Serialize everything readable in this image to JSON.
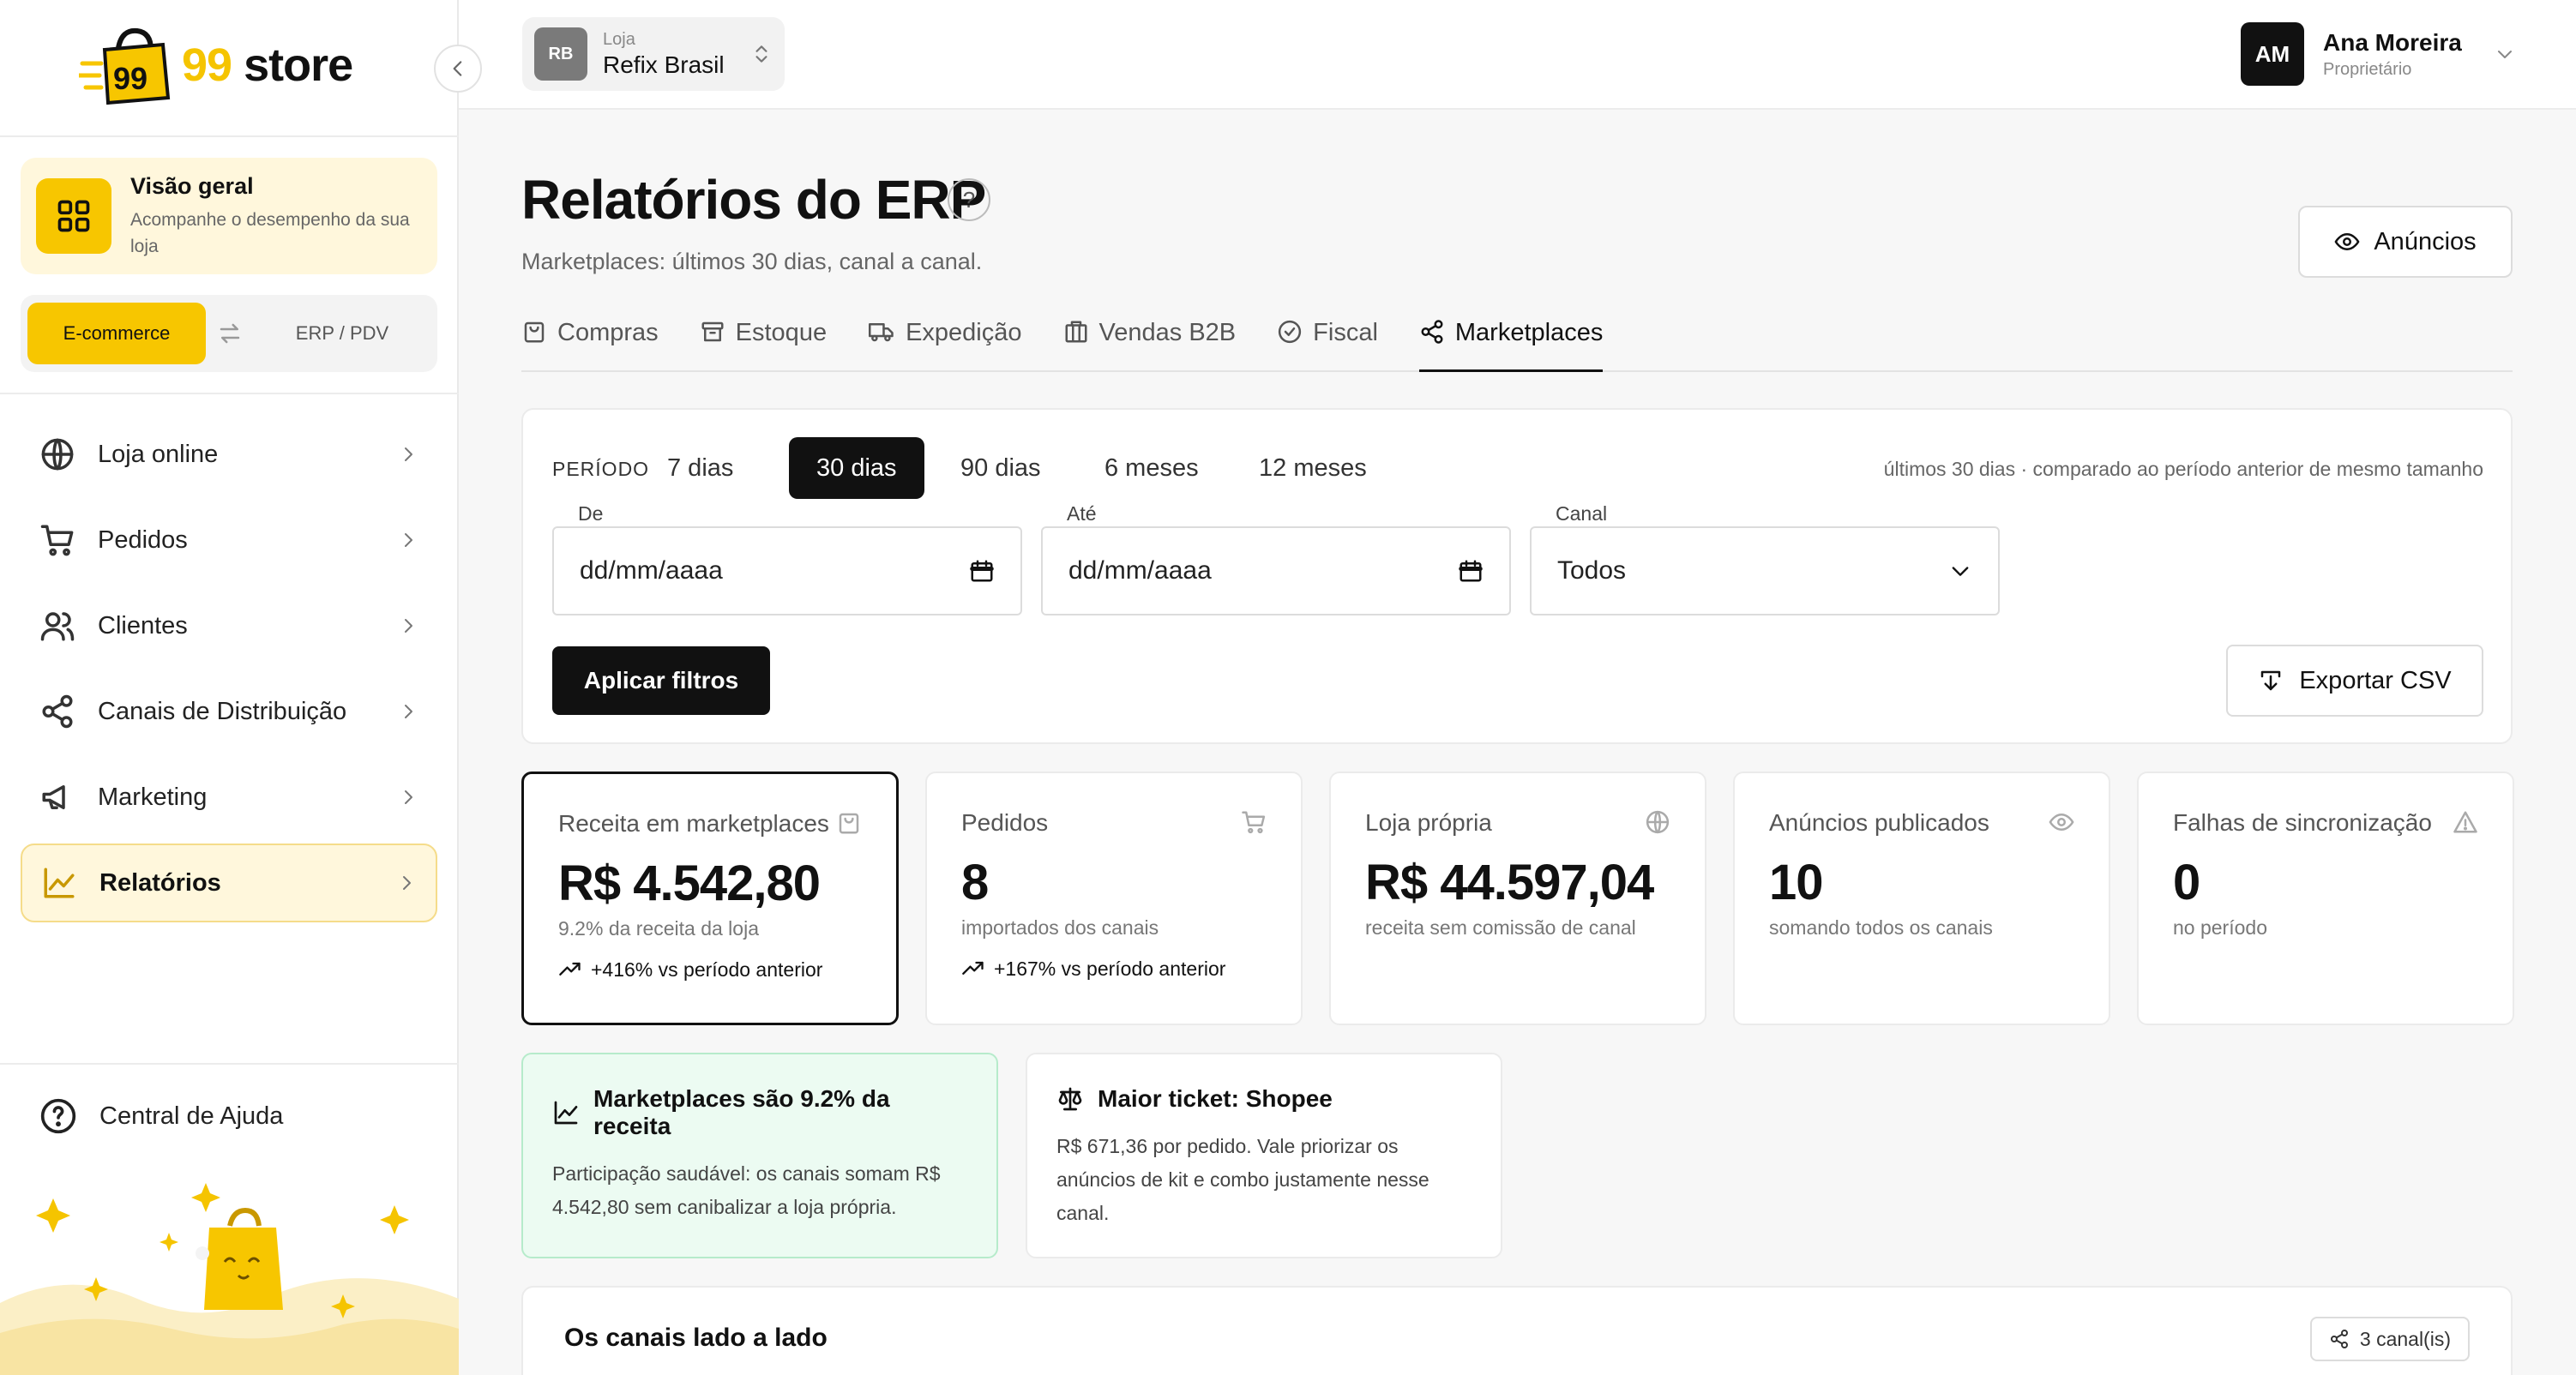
{
  "brand": {
    "name": "99 store"
  },
  "sidebar": {
    "overview": {
      "title": "Visão geral",
      "subtitle": "Acompanhe o desempenho da sua loja"
    },
    "mode_switch": {
      "active": "E-commerce",
      "inactive": "ERP / PDV"
    },
    "items": [
      {
        "label": "Loja online",
        "icon": "globe-icon"
      },
      {
        "label": "Pedidos",
        "icon": "cart-icon"
      },
      {
        "label": "Clientes",
        "icon": "users-icon"
      },
      {
        "label": "Canais de Distribuição",
        "icon": "share-icon"
      },
      {
        "label": "Marketing",
        "icon": "megaphone-icon"
      },
      {
        "label": "Relatórios",
        "icon": "chart-line-icon",
        "active": true
      }
    ],
    "help": "Central de Ajuda"
  },
  "topbar": {
    "store": {
      "initials": "RB",
      "label": "Loja",
      "name": "Refix Brasil"
    },
    "user": {
      "initials": "AM",
      "name": "Ana Moreira",
      "role": "Proprietário"
    }
  },
  "page": {
    "title": "Relatórios do ERP",
    "subtitle": "Marketplaces: últimos 30 dias, canal a canal.",
    "ads_button": "Anúncios"
  },
  "tabs": [
    {
      "label": "Compras",
      "icon": "bag-icon"
    },
    {
      "label": "Estoque",
      "icon": "archive-icon"
    },
    {
      "label": "Expedição",
      "icon": "truck-icon"
    },
    {
      "label": "Vendas B2B",
      "icon": "building-icon"
    },
    {
      "label": "Fiscal",
      "icon": "check-circle-icon"
    },
    {
      "label": "Marketplaces",
      "icon": "share-icon",
      "active": true
    }
  ],
  "filters": {
    "period_label": "PERÍODO",
    "periods": [
      "7 dias",
      "30 dias",
      "90 dias",
      "6 meses",
      "12 meses"
    ],
    "selected_period": "30 dias",
    "note": "últimos 30 dias · comparado ao período anterior de mesmo tamanho",
    "from": {
      "label": "De",
      "placeholder": "dd/mm/aaaa"
    },
    "to": {
      "label": "Até",
      "placeholder": "dd/mm/aaaa"
    },
    "channel": {
      "label": "Canal",
      "value": "Todos"
    },
    "apply": "Aplicar filtros",
    "export": "Exportar CSV"
  },
  "kpis": [
    {
      "title": "Receita em marketplaces",
      "value": "R$ 4.542,80",
      "sub": "9.2% da receita da loja",
      "trend": "+416% vs período anterior",
      "icon": "bag-icon"
    },
    {
      "title": "Pedidos",
      "value": "8",
      "sub": "importados dos canais",
      "trend": "+167% vs período anterior",
      "icon": "cart-icon"
    },
    {
      "title": "Loja própria",
      "value": "R$ 44.597,04",
      "sub": "receita sem comissão de canal",
      "icon": "globe-icon"
    },
    {
      "title": "Anúncios publicados",
      "value": "10",
      "sub": "somando todos os canais",
      "icon": "eye-icon"
    },
    {
      "title": "Falhas de sincronização",
      "value": "0",
      "sub": "no período",
      "icon": "alert-icon"
    }
  ],
  "insights": [
    {
      "title": "Marketplaces são 9.2% da receita",
      "body": "Participação saudável: os canais somam R$ 4.542,80 sem canibalizar a loja própria.",
      "icon": "chart-line-icon"
    },
    {
      "title": "Maior ticket: Shopee",
      "body": "R$ 671,36 por pedido. Vale priorizar os anúncios de kit e combo justamente nesse canal.",
      "icon": "scale-icon"
    }
  ],
  "channels_section": {
    "title": "Os canais lado a lado",
    "badge": "3 canal(is)"
  },
  "colors": {
    "accent": "#f7c600",
    "dark": "#111111",
    "success_bg": "#ecfbf2"
  }
}
